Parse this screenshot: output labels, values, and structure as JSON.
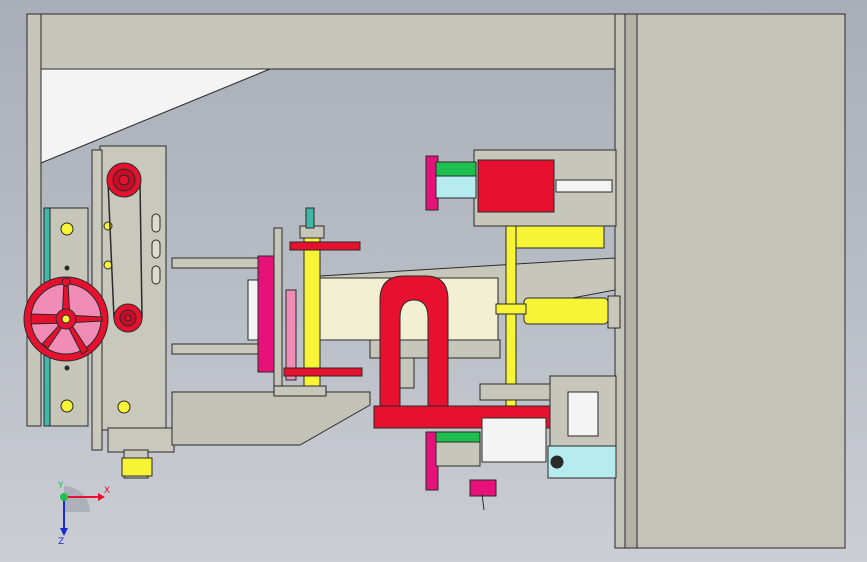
{
  "colors": {
    "frame": "#c5c4b8",
    "frame_dark": "#a6a597",
    "red": "#e8102f",
    "red_dark": "#b30a23",
    "magenta": "#e6127a",
    "yellow": "#f7f336",
    "cream": "#f2efd2",
    "teal": "#3fb8a8",
    "light_blue": "#b6ecef",
    "green": "#1fbf4f",
    "pink": "#f08cb6",
    "outline": "#2a2a2a"
  },
  "triad": {
    "x_label": "X",
    "y_label": "Y",
    "z_label": "Z"
  },
  "icons": {
    "handwheel": "handwheel-icon",
    "pulley": "pulley-icon",
    "triad": "coordinate-triad-icon"
  }
}
